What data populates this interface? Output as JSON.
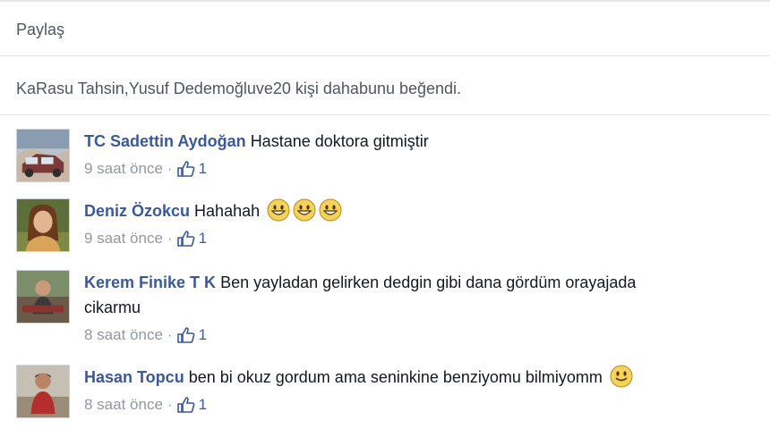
{
  "share": {
    "label": "Paylaş"
  },
  "likes": {
    "name1": "KaRasu Tahsin",
    "sep": ", ",
    "name2": "Yusuf Dedemoğlu",
    "and": " ve ",
    "others": "20 kişi daha",
    "suffix": " bunu beğendi."
  },
  "comments": [
    {
      "author": "TC Sadettin Aydoğan",
      "text": "Hastane doktora gitmiştir",
      "time": "9 saat önce",
      "likes": "1",
      "avatar": "avatar-car"
    },
    {
      "author": "Deniz Özokcu",
      "text": "Hahahah",
      "emojis": [
        "smiley-icon",
        "smiley-icon",
        "smiley-icon"
      ],
      "time": "9 saat önce",
      "likes": "1",
      "avatar": "avatar-woman"
    },
    {
      "author": "Kerem Finike T K",
      "text": "Ben yayladan gelirken dedgin gibi dana gördüm orayajada",
      "text2": "cikarmu",
      "time": "8 saat önce",
      "likes": "1",
      "avatar": "avatar-man"
    },
    {
      "author": "Hasan Topcu",
      "text": "ben bi okuz gordum ama seninkine benziyomu bilmiyomm",
      "emojis": [
        "smiley-icon"
      ],
      "time": "8 saat önce",
      "likes": "1",
      "avatar": "avatar-boy"
    }
  ],
  "meta": {
    "dot": "·",
    "like_icon": "thumbs-up-icon"
  },
  "colors": {
    "link": "#3b5998",
    "muted": "#9197a3",
    "text": "#141823",
    "divider": "#e1e2e3"
  }
}
